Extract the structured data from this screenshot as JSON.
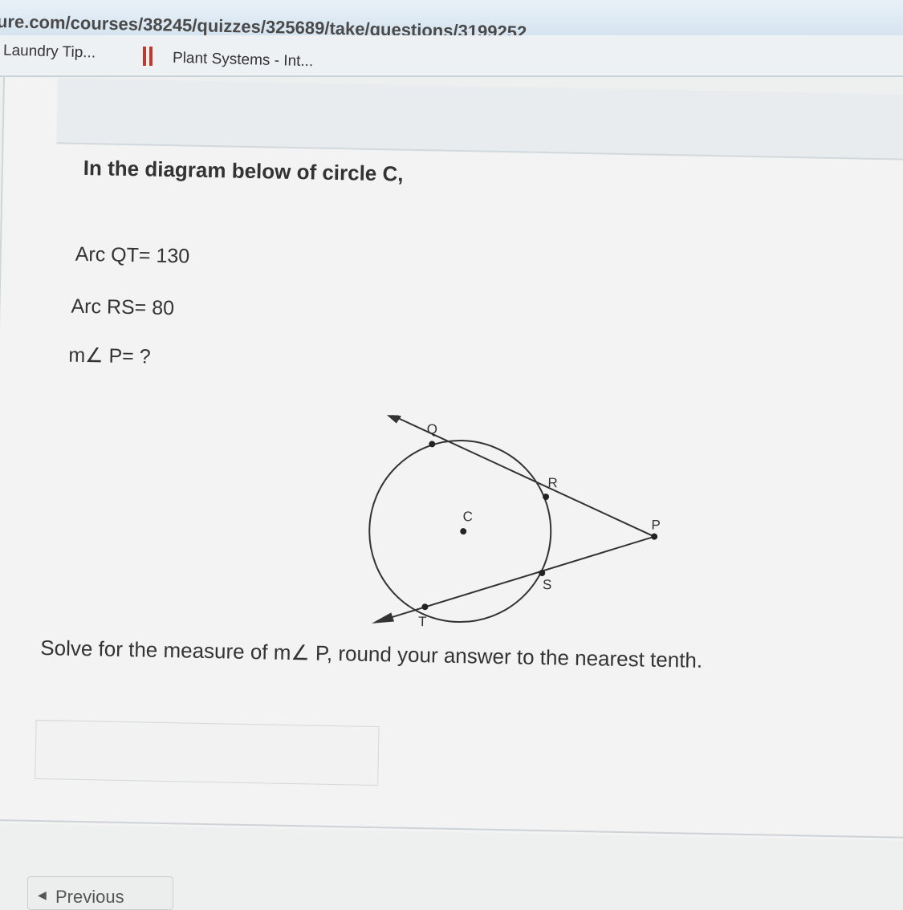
{
  "browser": {
    "url": "ure.com/courses/38245/quizzes/325689/take/questions/3199252",
    "bookmarks": [
      "Laundry Tip...",
      "Plant Systems - Int..."
    ]
  },
  "question": {
    "intro": "In the diagram below of circle C,",
    "given": [
      "Arc QT= 130",
      "Arc RS= 80",
      "m∠ P= ?"
    ],
    "prompt": "Solve for the measure of m∠ P, round your answer to the nearest tenth."
  },
  "diagram": {
    "labels": {
      "Q": "Q",
      "R": "R",
      "C": "C",
      "P": "P",
      "S": "S",
      "T": "T"
    }
  },
  "answer": {
    "value": ""
  },
  "nav": {
    "previous": "Previous"
  }
}
